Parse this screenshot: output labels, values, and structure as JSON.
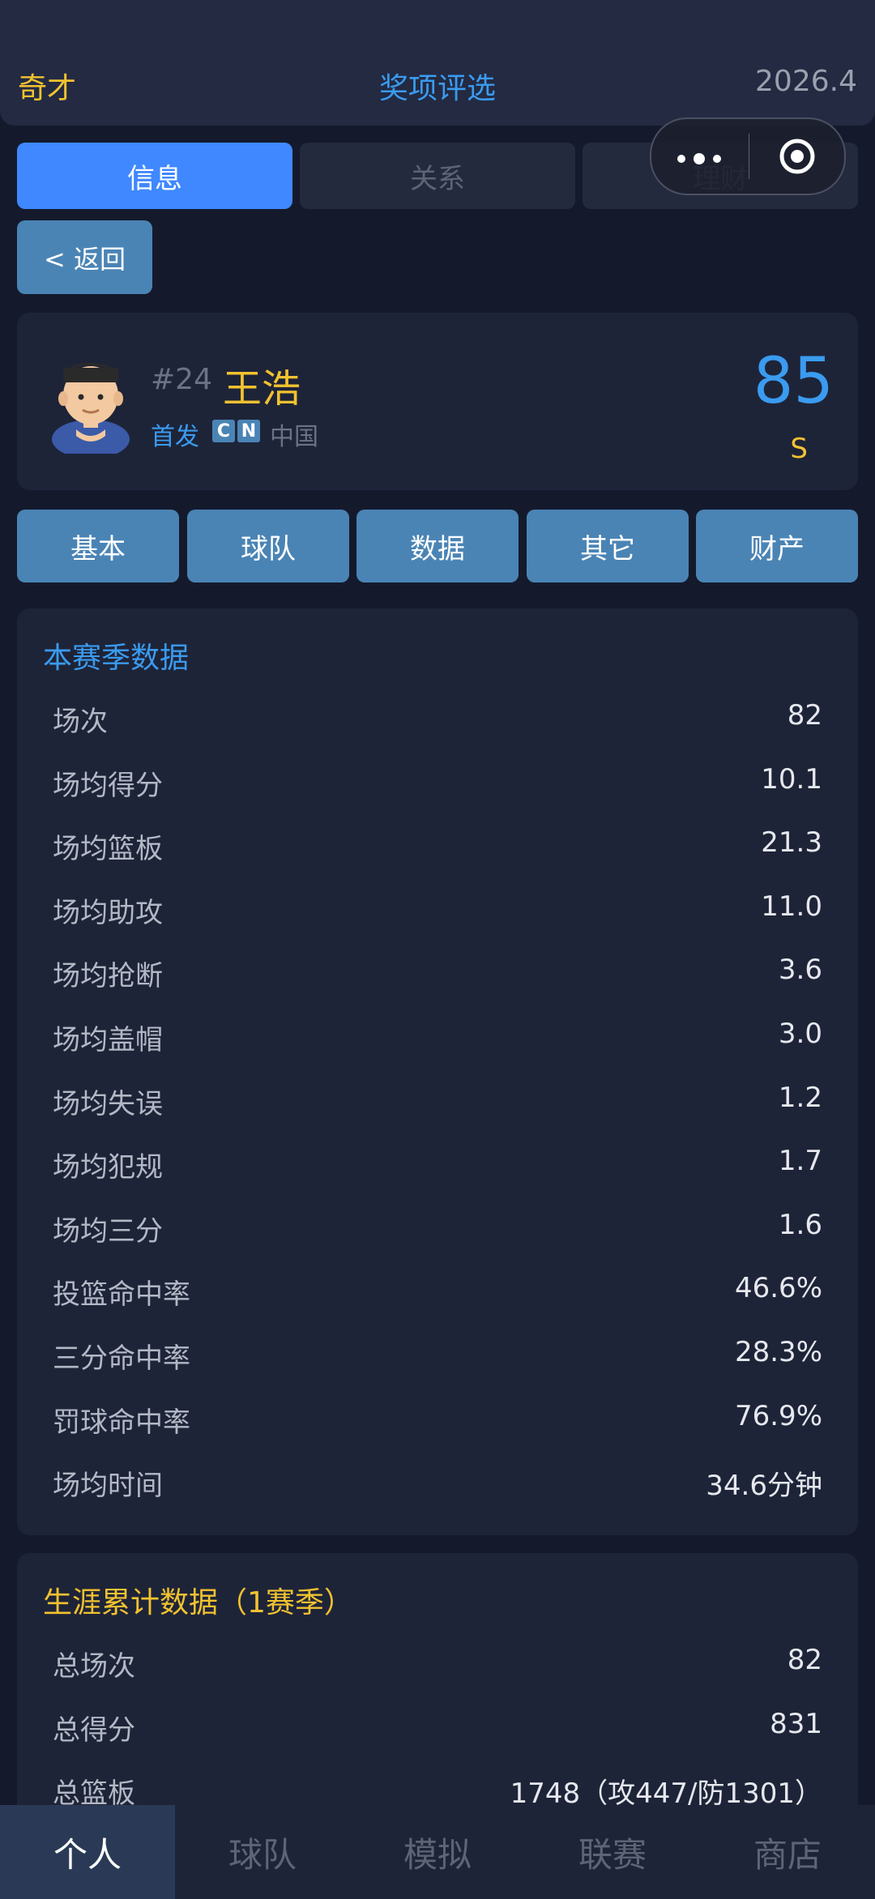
{
  "header": {
    "left": "奇才",
    "center": "奖项评选",
    "right": "2026.4"
  },
  "tabs": [
    {
      "label": "信息",
      "active": true
    },
    {
      "label": "关系",
      "active": false
    },
    {
      "label": "理财",
      "active": false
    }
  ],
  "back_label": "< 返回",
  "player": {
    "number": "#24",
    "name": "王浩",
    "status": "首发",
    "flag_letters": [
      "C",
      "N"
    ],
    "country": "中国",
    "rating": "85",
    "grade": "S"
  },
  "sub_tabs": [
    "基本",
    "球队",
    "数据",
    "其它",
    "财产"
  ],
  "season": {
    "title": "本赛季数据",
    "rows": [
      {
        "label": "场次",
        "value": "82"
      },
      {
        "label": "场均得分",
        "value": "10.1"
      },
      {
        "label": "场均篮板",
        "value": "21.3"
      },
      {
        "label": "场均助攻",
        "value": "11.0"
      },
      {
        "label": "场均抢断",
        "value": "3.6"
      },
      {
        "label": "场均盖帽",
        "value": "3.0"
      },
      {
        "label": "场均失误",
        "value": "1.2"
      },
      {
        "label": "场均犯规",
        "value": "1.7"
      },
      {
        "label": "场均三分",
        "value": "1.6"
      },
      {
        "label": "投篮命中率",
        "value": "46.6%"
      },
      {
        "label": "三分命中率",
        "value": "28.3%"
      },
      {
        "label": "罚球命中率",
        "value": "76.9%"
      },
      {
        "label": "场均时间",
        "value": "34.6分钟"
      }
    ]
  },
  "career": {
    "title": "生涯累计数据（1赛季）",
    "rows": [
      {
        "label": "总场次",
        "value": "82"
      },
      {
        "label": "总得分",
        "value": "831"
      },
      {
        "label": "总篮板",
        "value": "1748（攻447/防1301）"
      }
    ]
  },
  "bottom_nav": [
    {
      "label": "个人",
      "active": true
    },
    {
      "label": "球队",
      "active": false
    },
    {
      "label": "模拟",
      "active": false
    },
    {
      "label": "联赛",
      "active": false
    },
    {
      "label": "商店",
      "active": false
    }
  ],
  "colors": {
    "accent_blue": "#3f88ff",
    "gold": "#f2c230",
    "button_blue": "#4a84b5",
    "background": "#141a2c"
  }
}
